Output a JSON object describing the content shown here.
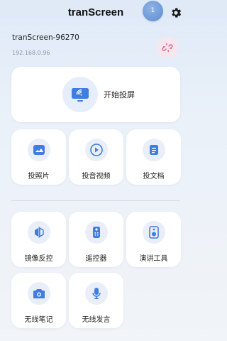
{
  "header": {
    "title": "tranScreen",
    "notification_count": "1"
  },
  "device": {
    "name": "tranScreen-96270",
    "ip": "192.168.0.96"
  },
  "main_action": {
    "label": "开始投屏"
  },
  "cast_options": [
    {
      "label": "投照片",
      "icon": "image-icon"
    },
    {
      "label": "投音视频",
      "icon": "play-icon"
    },
    {
      "label": "投文档",
      "icon": "document-icon"
    }
  ],
  "tools": [
    {
      "label": "镜像反控",
      "icon": "mirror-icon"
    },
    {
      "label": "遥控器",
      "icon": "remote-icon"
    },
    {
      "label": "演讲工具",
      "icon": "speaker-icon"
    },
    {
      "label": "无线笔记",
      "icon": "camera-icon"
    },
    {
      "label": "无线发言",
      "icon": "microphone-icon"
    }
  ],
  "colors": {
    "accent": "#3f7de0",
    "background_top": "#dfe9f7",
    "unlink_bg": "#f6e7ee",
    "unlink_icon": "#e26a8e"
  }
}
